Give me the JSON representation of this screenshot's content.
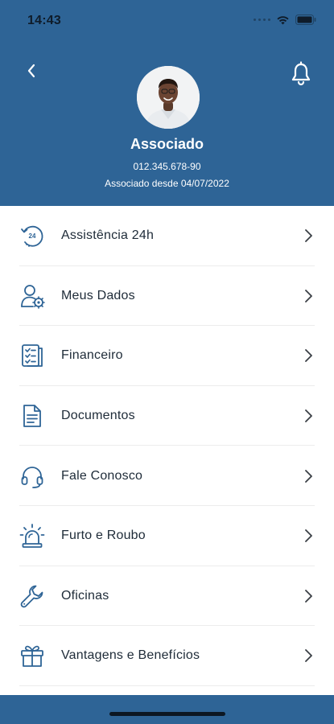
{
  "status_bar": {
    "time": "14:43"
  },
  "header": {
    "name": "Associado",
    "document": "012.345.678-90",
    "since": "Associado desde 04/07/2022"
  },
  "menu": {
    "items": [
      {
        "label": "Assistência 24h",
        "icon": "assistance-24h-icon"
      },
      {
        "label": "Meus Dados",
        "icon": "user-settings-icon"
      },
      {
        "label": "Financeiro",
        "icon": "finance-checklist-icon"
      },
      {
        "label": "Documentos",
        "icon": "document-icon"
      },
      {
        "label": "Fale Conosco",
        "icon": "headset-icon"
      },
      {
        "label": "Furto e Roubo",
        "icon": "alarm-siren-icon"
      },
      {
        "label": "Oficinas",
        "icon": "wrench-icon"
      },
      {
        "label": "Vantagens e Benefícios",
        "icon": "gift-icon"
      }
    ]
  },
  "colors": {
    "primary": "#2e6496",
    "icon": "#2e6496",
    "text": "#1e2b38",
    "divider": "#ececec"
  }
}
